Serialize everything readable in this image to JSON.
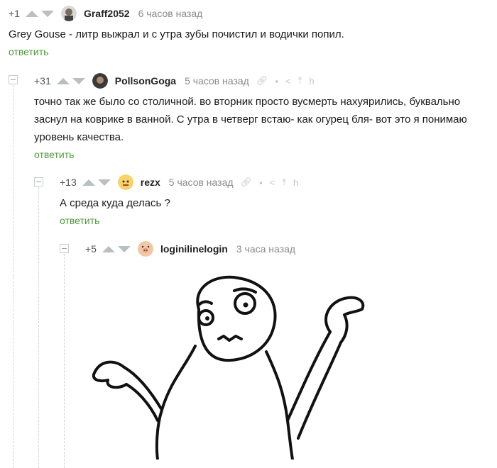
{
  "comments": [
    {
      "rating": "+1",
      "username": "Graff2052",
      "time": "6 часов назад",
      "text": "Grey Gouse - литр выжрал и с утра зубы почистил и водички попил.",
      "reply": "ответить"
    },
    {
      "rating": "+31",
      "username": "PollsonGoga",
      "time": "5 часов назад",
      "text": "точно так же было со столичной. во вторник просто вусмерть нахуярились, буквально заснул на коврике в ванной. С утра в четверг встаю- как огурец бля- вот это я понимаю уровень качества.",
      "reply": "ответить"
    },
    {
      "rating": "+13",
      "username": "rezx",
      "time": "5 часов назад",
      "text": "А среда куда делась ?",
      "reply": "ответить"
    },
    {
      "rating": "+5",
      "username": "loginilinelogin",
      "time": "3 часа назад"
    }
  ],
  "icons": {
    "up": "triangle-up-icon",
    "down": "triangle-down-icon",
    "actions": [
      "link-icon",
      "save-icon",
      "share-icon",
      "pin-icon",
      "more-icon"
    ]
  },
  "colors": {
    "reply": "#4e9a39",
    "meta": "#8a8a8a",
    "vote": "#b9bfc3"
  }
}
